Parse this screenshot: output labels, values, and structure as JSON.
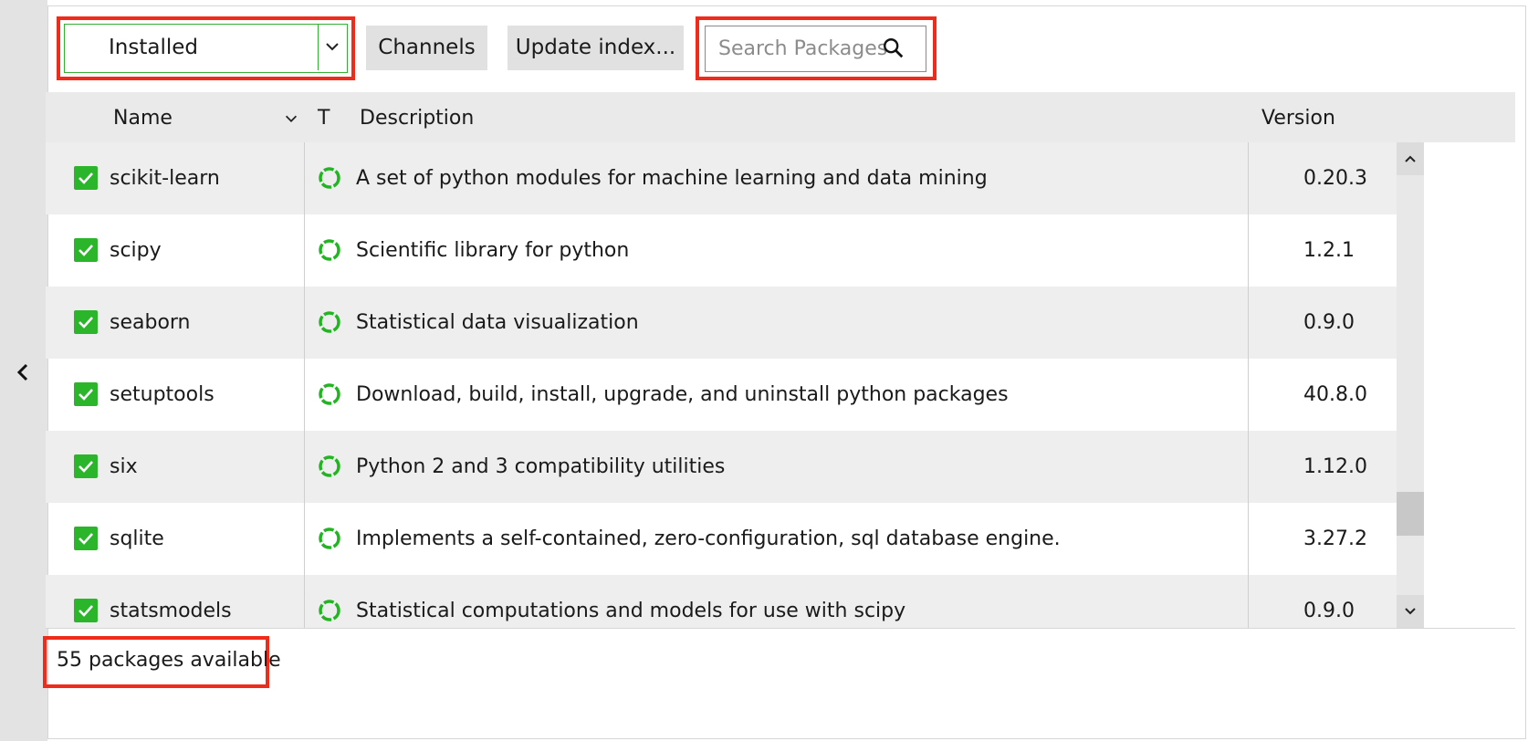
{
  "filter": {
    "selected": "Installed"
  },
  "toolbar": {
    "channels_label": "Channels",
    "update_index_label": "Update index..."
  },
  "search": {
    "placeholder": "Search Packages"
  },
  "table": {
    "headers": {
      "name": "Name",
      "type": "T",
      "description": "Description",
      "version": "Version"
    },
    "rows": [
      {
        "name": "scikit-learn",
        "description": "A set of python modules for machine learning and data mining",
        "version": "0.20.3",
        "checked": true
      },
      {
        "name": "scipy",
        "description": "Scientific library for python",
        "version": "1.2.1",
        "checked": true
      },
      {
        "name": "seaborn",
        "description": "Statistical data visualization",
        "version": "0.9.0",
        "checked": true
      },
      {
        "name": "setuptools",
        "description": "Download, build, install, upgrade, and uninstall python packages",
        "version": "40.8.0",
        "checked": true
      },
      {
        "name": "six",
        "description": "Python 2 and 3 compatibility utilities",
        "version": "1.12.0",
        "checked": true
      },
      {
        "name": "sqlite",
        "description": "Implements a self-contained, zero-configuration, sql database engine.",
        "version": "3.27.2",
        "checked": true
      },
      {
        "name": "statsmodels",
        "description": "Statistical computations and models for use with scipy",
        "version": "0.9.0",
        "checked": true
      }
    ]
  },
  "footer": {
    "status": "55 packages available"
  },
  "colors": {
    "highlight": "#ef2b1c",
    "checkbox": "#2ab52a",
    "status_ring": "#22b522"
  },
  "icons": {
    "collapse": "chevron-left-icon",
    "dropdown": "chevron-down-icon",
    "search": "search-icon",
    "status": "installed-status-icon",
    "check": "checkmark-icon"
  }
}
